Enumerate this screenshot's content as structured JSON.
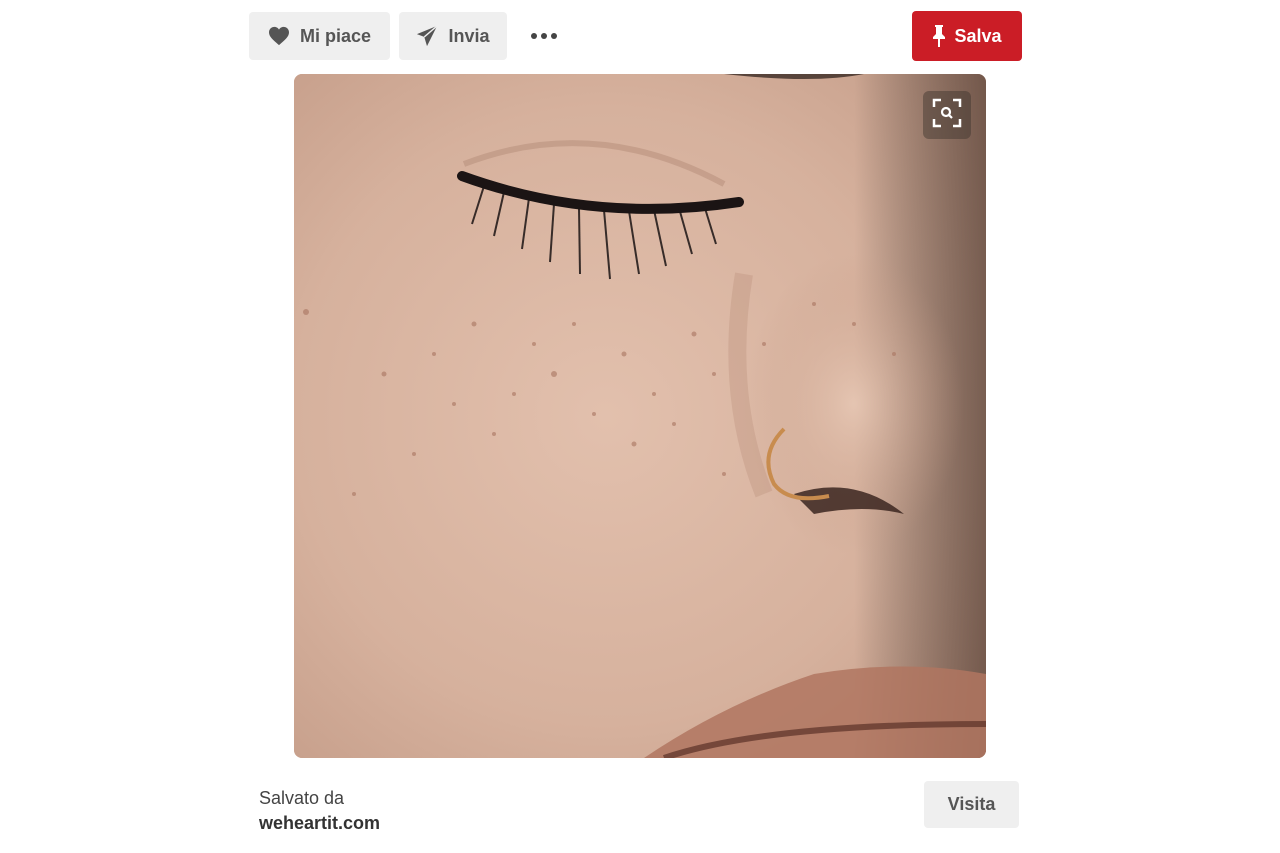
{
  "toolbar": {
    "like_label": "Mi piace",
    "send_label": "Invia",
    "save_label": "Salva"
  },
  "icons": {
    "like": "heart-icon",
    "send": "paper-plane-icon",
    "more": "more-dots-icon",
    "save": "pushpin-icon",
    "lens": "visual-search-icon"
  },
  "colors": {
    "save_accent": "#cb1d26",
    "button_gray": "#efefef"
  },
  "footer": {
    "saved_by_label": "Salvato da",
    "source": "weheartit.com",
    "visit_label": "Visita"
  }
}
